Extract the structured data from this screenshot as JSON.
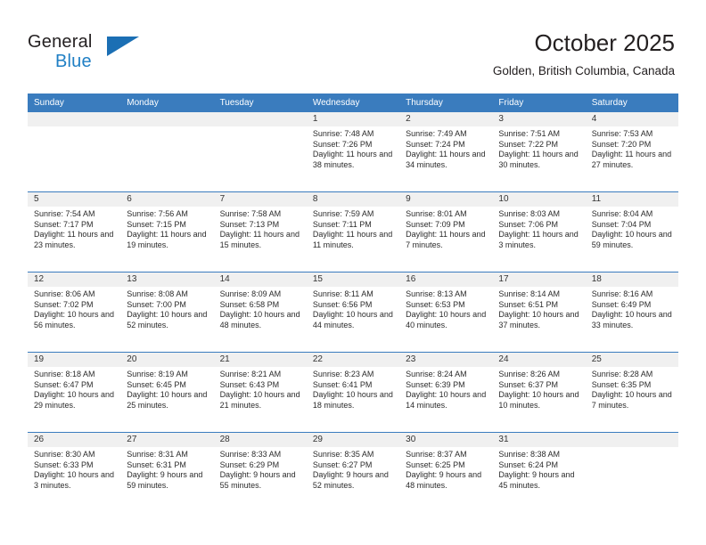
{
  "brand": {
    "name_part1": "General",
    "name_part2": "Blue",
    "accent_color": "#1b6fb4"
  },
  "header": {
    "title": "October 2025",
    "subtitle": "Golden, British Columbia, Canada"
  },
  "theme": {
    "header_row_bg": "#3a7cbe",
    "day_band_bg": "#f0f0f0",
    "text_color": "#231f20"
  },
  "weekdays": [
    "Sunday",
    "Monday",
    "Tuesday",
    "Wednesday",
    "Thursday",
    "Friday",
    "Saturday"
  ],
  "weeks": [
    [
      {
        "num": "",
        "empty": true
      },
      {
        "num": "",
        "empty": true
      },
      {
        "num": "",
        "empty": true
      },
      {
        "num": "1",
        "sunrise": "Sunrise: 7:48 AM",
        "sunset": "Sunset: 7:26 PM",
        "daylight": "Daylight: 11 hours and 38 minutes."
      },
      {
        "num": "2",
        "sunrise": "Sunrise: 7:49 AM",
        "sunset": "Sunset: 7:24 PM",
        "daylight": "Daylight: 11 hours and 34 minutes."
      },
      {
        "num": "3",
        "sunrise": "Sunrise: 7:51 AM",
        "sunset": "Sunset: 7:22 PM",
        "daylight": "Daylight: 11 hours and 30 minutes."
      },
      {
        "num": "4",
        "sunrise": "Sunrise: 7:53 AM",
        "sunset": "Sunset: 7:20 PM",
        "daylight": "Daylight: 11 hours and 27 minutes."
      }
    ],
    [
      {
        "num": "5",
        "sunrise": "Sunrise: 7:54 AM",
        "sunset": "Sunset: 7:17 PM",
        "daylight": "Daylight: 11 hours and 23 minutes."
      },
      {
        "num": "6",
        "sunrise": "Sunrise: 7:56 AM",
        "sunset": "Sunset: 7:15 PM",
        "daylight": "Daylight: 11 hours and 19 minutes."
      },
      {
        "num": "7",
        "sunrise": "Sunrise: 7:58 AM",
        "sunset": "Sunset: 7:13 PM",
        "daylight": "Daylight: 11 hours and 15 minutes."
      },
      {
        "num": "8",
        "sunrise": "Sunrise: 7:59 AM",
        "sunset": "Sunset: 7:11 PM",
        "daylight": "Daylight: 11 hours and 11 minutes."
      },
      {
        "num": "9",
        "sunrise": "Sunrise: 8:01 AM",
        "sunset": "Sunset: 7:09 PM",
        "daylight": "Daylight: 11 hours and 7 minutes."
      },
      {
        "num": "10",
        "sunrise": "Sunrise: 8:03 AM",
        "sunset": "Sunset: 7:06 PM",
        "daylight": "Daylight: 11 hours and 3 minutes."
      },
      {
        "num": "11",
        "sunrise": "Sunrise: 8:04 AM",
        "sunset": "Sunset: 7:04 PM",
        "daylight": "Daylight: 10 hours and 59 minutes."
      }
    ],
    [
      {
        "num": "12",
        "sunrise": "Sunrise: 8:06 AM",
        "sunset": "Sunset: 7:02 PM",
        "daylight": "Daylight: 10 hours and 56 minutes."
      },
      {
        "num": "13",
        "sunrise": "Sunrise: 8:08 AM",
        "sunset": "Sunset: 7:00 PM",
        "daylight": "Daylight: 10 hours and 52 minutes."
      },
      {
        "num": "14",
        "sunrise": "Sunrise: 8:09 AM",
        "sunset": "Sunset: 6:58 PM",
        "daylight": "Daylight: 10 hours and 48 minutes."
      },
      {
        "num": "15",
        "sunrise": "Sunrise: 8:11 AM",
        "sunset": "Sunset: 6:56 PM",
        "daylight": "Daylight: 10 hours and 44 minutes."
      },
      {
        "num": "16",
        "sunrise": "Sunrise: 8:13 AM",
        "sunset": "Sunset: 6:53 PM",
        "daylight": "Daylight: 10 hours and 40 minutes."
      },
      {
        "num": "17",
        "sunrise": "Sunrise: 8:14 AM",
        "sunset": "Sunset: 6:51 PM",
        "daylight": "Daylight: 10 hours and 37 minutes."
      },
      {
        "num": "18",
        "sunrise": "Sunrise: 8:16 AM",
        "sunset": "Sunset: 6:49 PM",
        "daylight": "Daylight: 10 hours and 33 minutes."
      }
    ],
    [
      {
        "num": "19",
        "sunrise": "Sunrise: 8:18 AM",
        "sunset": "Sunset: 6:47 PM",
        "daylight": "Daylight: 10 hours and 29 minutes."
      },
      {
        "num": "20",
        "sunrise": "Sunrise: 8:19 AM",
        "sunset": "Sunset: 6:45 PM",
        "daylight": "Daylight: 10 hours and 25 minutes."
      },
      {
        "num": "21",
        "sunrise": "Sunrise: 8:21 AM",
        "sunset": "Sunset: 6:43 PM",
        "daylight": "Daylight: 10 hours and 21 minutes."
      },
      {
        "num": "22",
        "sunrise": "Sunrise: 8:23 AM",
        "sunset": "Sunset: 6:41 PM",
        "daylight": "Daylight: 10 hours and 18 minutes."
      },
      {
        "num": "23",
        "sunrise": "Sunrise: 8:24 AM",
        "sunset": "Sunset: 6:39 PM",
        "daylight": "Daylight: 10 hours and 14 minutes."
      },
      {
        "num": "24",
        "sunrise": "Sunrise: 8:26 AM",
        "sunset": "Sunset: 6:37 PM",
        "daylight": "Daylight: 10 hours and 10 minutes."
      },
      {
        "num": "25",
        "sunrise": "Sunrise: 8:28 AM",
        "sunset": "Sunset: 6:35 PM",
        "daylight": "Daylight: 10 hours and 7 minutes."
      }
    ],
    [
      {
        "num": "26",
        "sunrise": "Sunrise: 8:30 AM",
        "sunset": "Sunset: 6:33 PM",
        "daylight": "Daylight: 10 hours and 3 minutes."
      },
      {
        "num": "27",
        "sunrise": "Sunrise: 8:31 AM",
        "sunset": "Sunset: 6:31 PM",
        "daylight": "Daylight: 9 hours and 59 minutes."
      },
      {
        "num": "28",
        "sunrise": "Sunrise: 8:33 AM",
        "sunset": "Sunset: 6:29 PM",
        "daylight": "Daylight: 9 hours and 55 minutes."
      },
      {
        "num": "29",
        "sunrise": "Sunrise: 8:35 AM",
        "sunset": "Sunset: 6:27 PM",
        "daylight": "Daylight: 9 hours and 52 minutes."
      },
      {
        "num": "30",
        "sunrise": "Sunrise: 8:37 AM",
        "sunset": "Sunset: 6:25 PM",
        "daylight": "Daylight: 9 hours and 48 minutes."
      },
      {
        "num": "31",
        "sunrise": "Sunrise: 8:38 AM",
        "sunset": "Sunset: 6:24 PM",
        "daylight": "Daylight: 9 hours and 45 minutes."
      },
      {
        "num": "",
        "empty": true
      }
    ]
  ]
}
